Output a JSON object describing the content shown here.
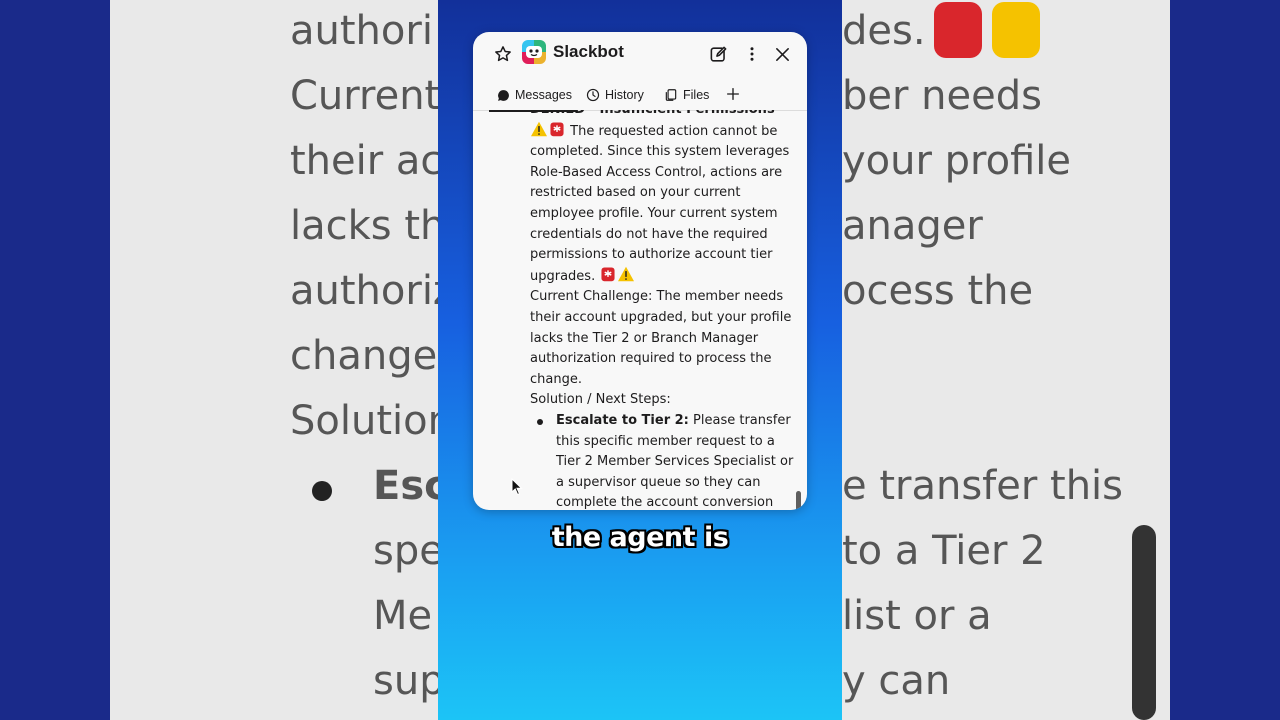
{
  "background_zoom": {
    "left_lines": [
      "authori",
      "Current",
      "their ac",
      "lacks th",
      "authoriz",
      "change.",
      "Solution",
      "Esc",
      "spe",
      "Me",
      "sup"
    ],
    "right_lines": [
      "des.",
      "ber needs",
      "your profile",
      "anager",
      "ocess the",
      "e transfer this",
      "to a Tier 2",
      "list or a",
      "y can"
    ]
  },
  "slack": {
    "title": "Slackbot",
    "tabs": [
      {
        "label": "Messages",
        "icon": "message-bubble-icon",
        "active": true
      },
      {
        "label": "History",
        "icon": "clock-icon",
        "active": false
      },
      {
        "label": "Files",
        "icon": "files-icon",
        "active": false
      }
    ],
    "message": {
      "heading": "DENIED - Insufficient Permissions",
      "para1": "The requested action cannot be completed. Since this system leverages Role-Based Access Control, actions are restricted based on your current employee profile. Your current system credentials do not have the required permissions to authorize account tier upgrades.",
      "challenge": "Current Challenge: The member needs their account upgraded, but your profile lacks the Tier 2 or Branch Manager authorization required to process the change.",
      "solution_label": "Solution / Next Steps:",
      "steps": [
        {
          "bold": "Escalate to Tier 2:",
          "text": "Please transfer this specific member request to a Tier 2 Member Services Specialist or a supervisor queue so they can complete the account conversion for the member today."
        }
      ]
    }
  },
  "caption": "the agent is",
  "colors": {
    "gradient_top": "#12309a",
    "gradient_bottom": "#1cc4f6",
    "window_bg": "#f8f8f8",
    "text": "#1d1c1d"
  }
}
